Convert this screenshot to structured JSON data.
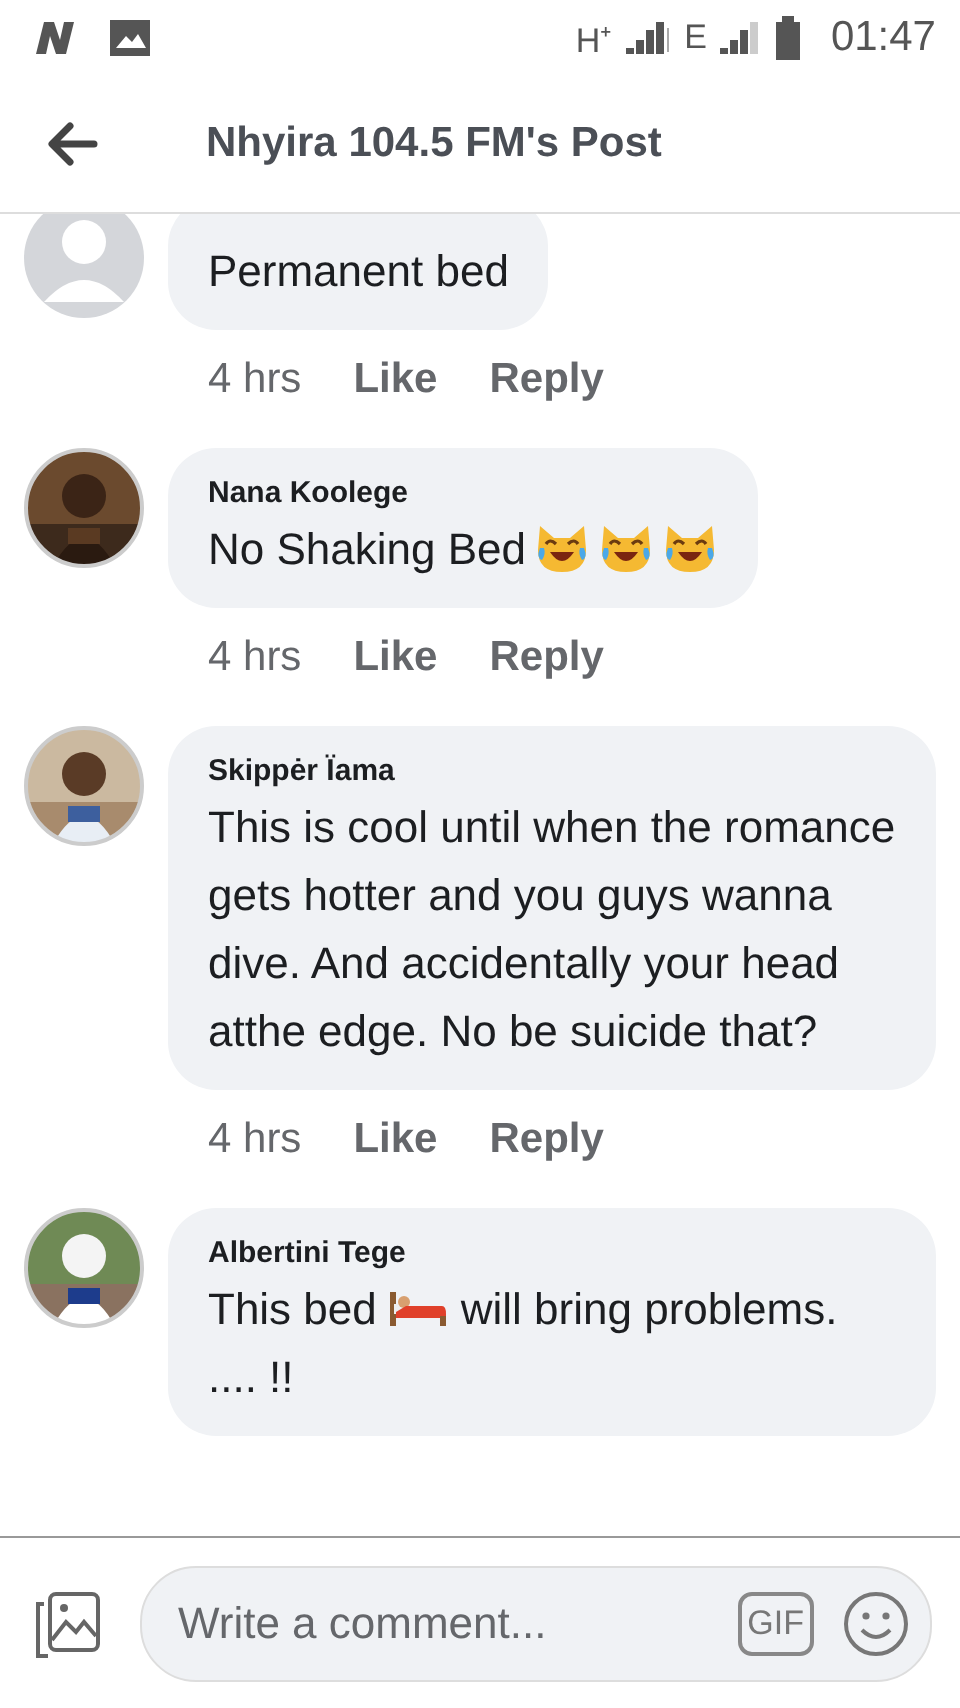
{
  "status_bar": {
    "network_1": "H⁺",
    "network_2": "E",
    "time": "01:47"
  },
  "header": {
    "title": "Nhyira 104.5 FM's Post"
  },
  "comments": [
    {
      "avatar": {
        "kind": "generic"
      },
      "body": [
        {
          "kind": "text",
          "text": "Permanent bed"
        }
      ],
      "time": "4 hrs",
      "like": "Like",
      "reply": "Reply"
    },
    {
      "author": "Nana Koolege",
      "body": [
        {
          "kind": "text",
          "text": "No Shaking Bed"
        },
        {
          "kind": "cat"
        },
        {
          "kind": "cat"
        },
        {
          "kind": "cat"
        }
      ],
      "time": "4 hrs",
      "like": "Like",
      "reply": "Reply"
    },
    {
      "author": "Skippėr Ïama",
      "body": [
        {
          "kind": "text",
          "text": "This is cool until when the romance gets hotter and you guys wanna dive. And accidentally your head atthe edge. No be suicide that?"
        }
      ],
      "time": "4 hrs",
      "like": "Like",
      "reply": "Reply"
    },
    {
      "author": "Albertini Tege",
      "body": [
        {
          "kind": "text",
          "text": "This bed"
        },
        {
          "kind": "bed"
        },
        {
          "kind": "text",
          "text": "will bring problems."
        },
        {
          "kind": "text",
          "text": ".... !!"
        }
      ]
    }
  ],
  "composer": {
    "placeholder": "Write a comment...",
    "gif": "GIF"
  }
}
